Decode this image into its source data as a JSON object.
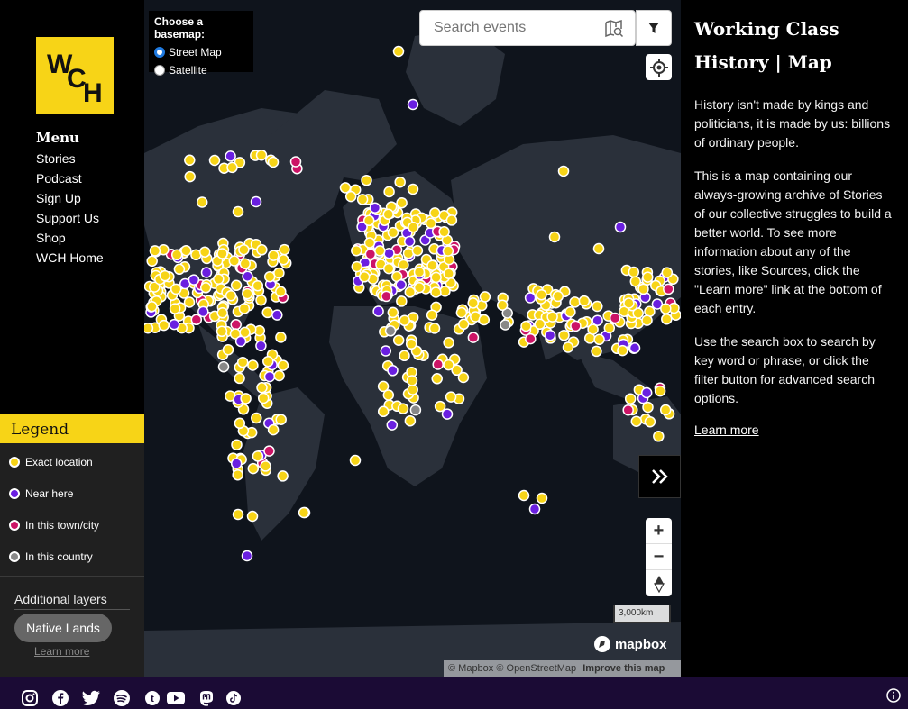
{
  "logo": {
    "text": "WCH",
    "color": "#f7d417"
  },
  "menu": {
    "title": "Menu",
    "items": [
      "Stories",
      "Podcast",
      "Sign Up",
      "Support Us",
      "Shop",
      "WCH Home"
    ]
  },
  "legend": {
    "title": "Legend",
    "items": [
      {
        "label": "Exact location",
        "color": "#f7d417"
      },
      {
        "label": "Near here",
        "color": "#6a1fe0"
      },
      {
        "label": "In this town/city",
        "color": "#cc1466"
      },
      {
        "label": "In this country",
        "color": "#888888"
      }
    ],
    "layers_title": "Additional layers",
    "native_lands": "Native Lands",
    "learn_more": "Learn more"
  },
  "basemap": {
    "title": "Choose a basemap:",
    "options": [
      "Street Map",
      "Satellite"
    ],
    "selected": "Street Map"
  },
  "search": {
    "placeholder": "Search events"
  },
  "map": {
    "scale": "3,000km",
    "attribution": "© Mapbox © OpenStreetMap",
    "improve": "Improve this map",
    "brand": "mapbox",
    "icons": [
      "filter-icon",
      "locate-icon",
      "expand-icon",
      "zoom-in-icon",
      "zoom-out-icon",
      "compass-icon"
    ]
  },
  "info": {
    "title_line1": "Working Class",
    "title_line2": "History | Map",
    "p1": "History isn't made by kings and politicians, it is made by us: billions of ordinary people.",
    "p2": "This is a map containing our always-growing archive of Stories of our collective struggles to build a better world. To see more information about any of the stories, like Sources, click the \"Learn more\" link at the bottom of each entry.",
    "p3": "Use the search box to search by key word or phrase, or click the filter button for advanced search options.",
    "learn_more": "Learn more"
  },
  "footer": {
    "socials": [
      "instagram-icon",
      "facebook-icon",
      "twitter-icon",
      "spotify-icon",
      "tumblr-icon",
      "youtube-icon",
      "mastodon-icon",
      "tiktok-icon"
    ]
  }
}
